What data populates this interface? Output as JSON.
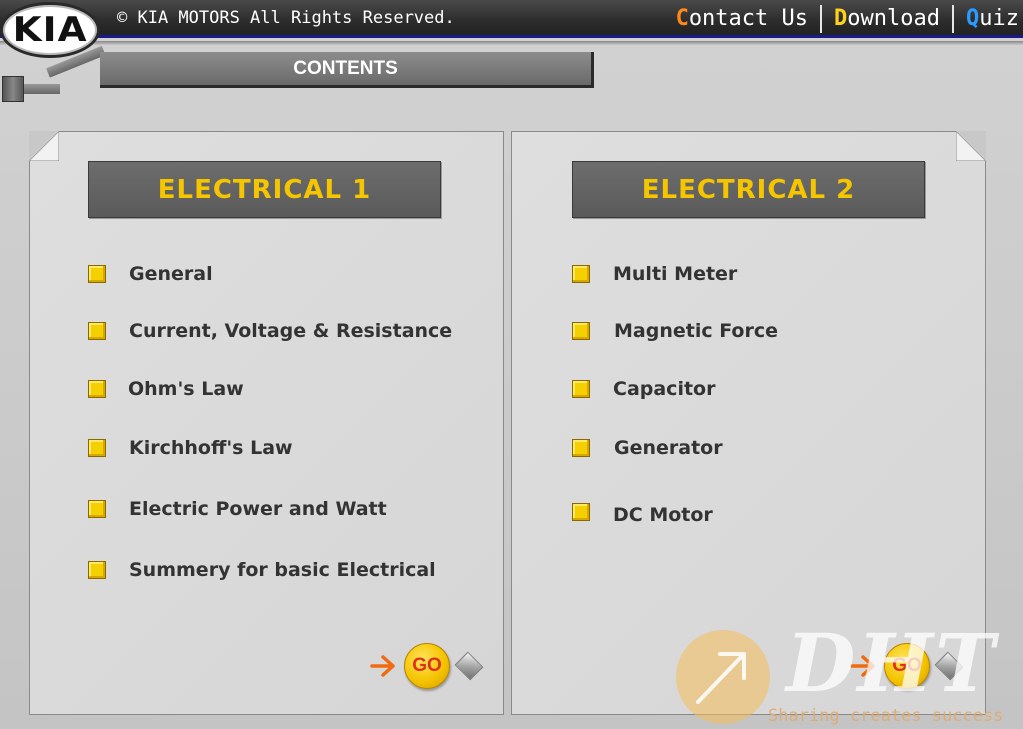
{
  "header": {
    "logo_text": "KIA",
    "copyright": "© KIA MOTORS All Rights Reserved.",
    "nav": [
      {
        "first": "C",
        "rest": "ontact Us",
        "color": "#ff8a1a"
      },
      {
        "first": "D",
        "rest": "ownload",
        "color": "#ffd21a"
      },
      {
        "first": "Q",
        "rest": "uiz",
        "color": "#2a9bff"
      }
    ]
  },
  "contents_label": "CONTENTS",
  "panels": {
    "left": {
      "title": "ELECTRICAL 1",
      "items": [
        "General",
        "Current, Voltage & Resistance",
        "Ohm's Law",
        "Kirchhoff's Law",
        "Electric Power and Watt",
        "Summery for basic Electrical"
      ],
      "go_label": "GO"
    },
    "right": {
      "title": "ELECTRICAL 2",
      "items": [
        "Multi Meter",
        "Magnetic Force",
        "Capacitor",
        "Generator",
        "DC Motor"
      ],
      "go_label": "GO"
    }
  },
  "watermark": {
    "brand": "DHT",
    "tagline": "Sharing creates success"
  },
  "colors": {
    "title_text": "#f5c600",
    "bullet": "#f5d000",
    "go_text": "#e0301e",
    "go_arrow": "#f06a10",
    "header_bg": "#2c2c2c"
  }
}
